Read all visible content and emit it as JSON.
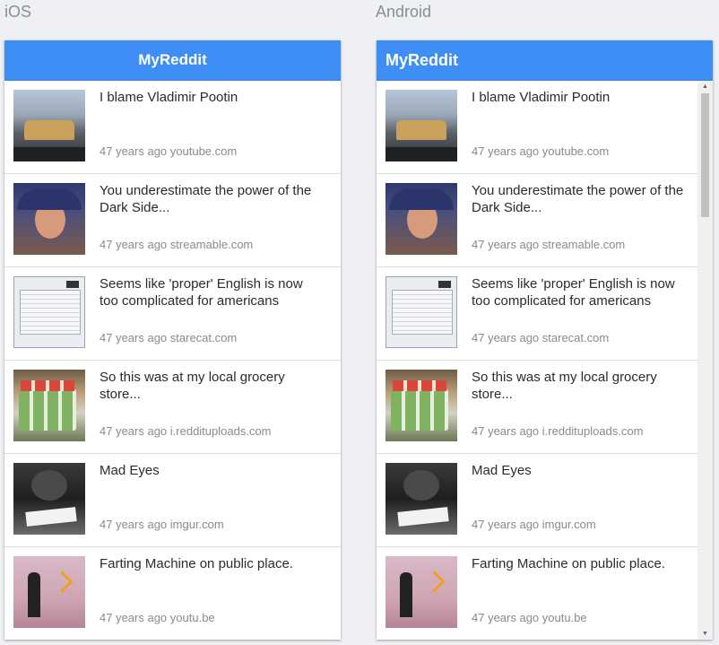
{
  "labels": {
    "ios": "iOS",
    "android": "Android"
  },
  "app": {
    "title": "MyReddit"
  },
  "posts": [
    {
      "title": "I blame Vladimir Pootin",
      "meta": "47 years ago youtube.com",
      "thumb": "dashcam-thumbnail"
    },
    {
      "title": "You underestimate the power of the Dark Side...",
      "meta": "47 years ago streamable.com",
      "thumb": "hooded-man-thumbnail"
    },
    {
      "title": "Seems like 'proper' English is now too complicated for americans",
      "meta": "47 years ago starecat.com",
      "thumb": "dialog-screenshot-thumbnail"
    },
    {
      "title": "So this was at my local grocery store...",
      "meta": "47 years ago i.reddituploads.com",
      "thumb": "grocery-thumbnail"
    },
    {
      "title": "Mad Eyes",
      "meta": "47 years ago imgur.com",
      "thumb": "cat-thumbnail"
    },
    {
      "title": "Farting Machine on public place.",
      "meta": "47 years ago youtu.be",
      "thumb": "street-thumbnail"
    }
  ],
  "colors": {
    "appbar": "#3f8ef5",
    "background": "#eff0f4"
  },
  "scrollbar": {
    "up_icon": "▲",
    "down_icon": "▼"
  }
}
